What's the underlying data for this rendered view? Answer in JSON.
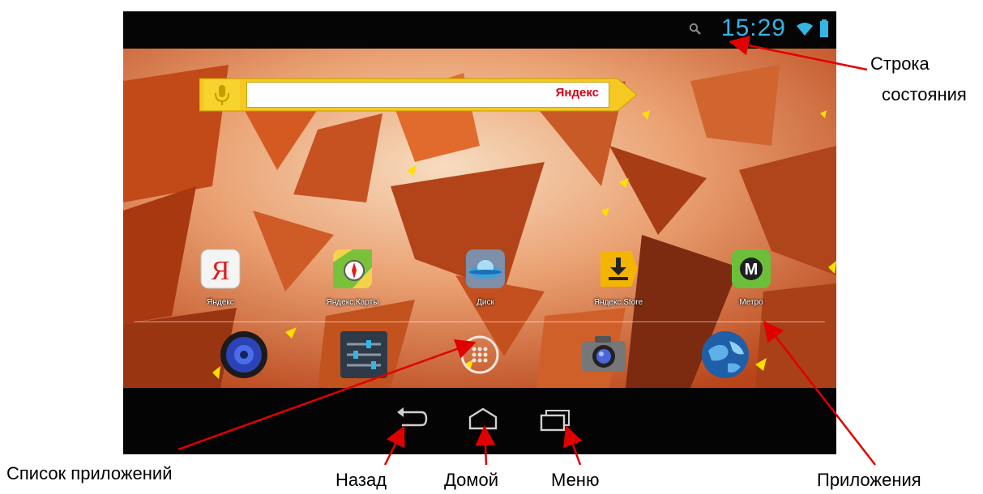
{
  "status_bar": {
    "time": "15:29",
    "search_icon": "search-icon",
    "wifi_icon": "wifi-icon",
    "battery_icon": "battery-icon"
  },
  "search_widget": {
    "brand": "Яндекс",
    "mic_icon": "microphone-icon"
  },
  "apps": [
    {
      "label": "Яндекс",
      "icon": "yandex-icon"
    },
    {
      "label": "Яндекс.Карты",
      "icon": "maps-icon"
    },
    {
      "label": "Диск",
      "icon": "disk-icon"
    },
    {
      "label": "Яндекс.Store",
      "icon": "store-download-icon"
    },
    {
      "label": "Метро",
      "icon": "metro-icon"
    }
  ],
  "dock": [
    {
      "icon": "speaker-icon"
    },
    {
      "icon": "settings-sliders-icon"
    },
    {
      "icon": "app-drawer-icon"
    },
    {
      "icon": "camera-icon"
    },
    {
      "icon": "browser-globe-icon"
    }
  ],
  "nav_bar": {
    "back_icon": "back-icon",
    "home_icon": "home-icon",
    "recents_icon": "recents-icon"
  },
  "annotations": {
    "status_bar_line1": "Строка",
    "status_bar_line2": "состояния",
    "app_list": "Список приложений",
    "back": "Назад",
    "home": "Домой",
    "menu": "Меню",
    "apps": "Приложения"
  },
  "colors": {
    "accent_time": "#33b5e5",
    "arrow": "#e00000",
    "wallpaper": "#d9501c"
  }
}
